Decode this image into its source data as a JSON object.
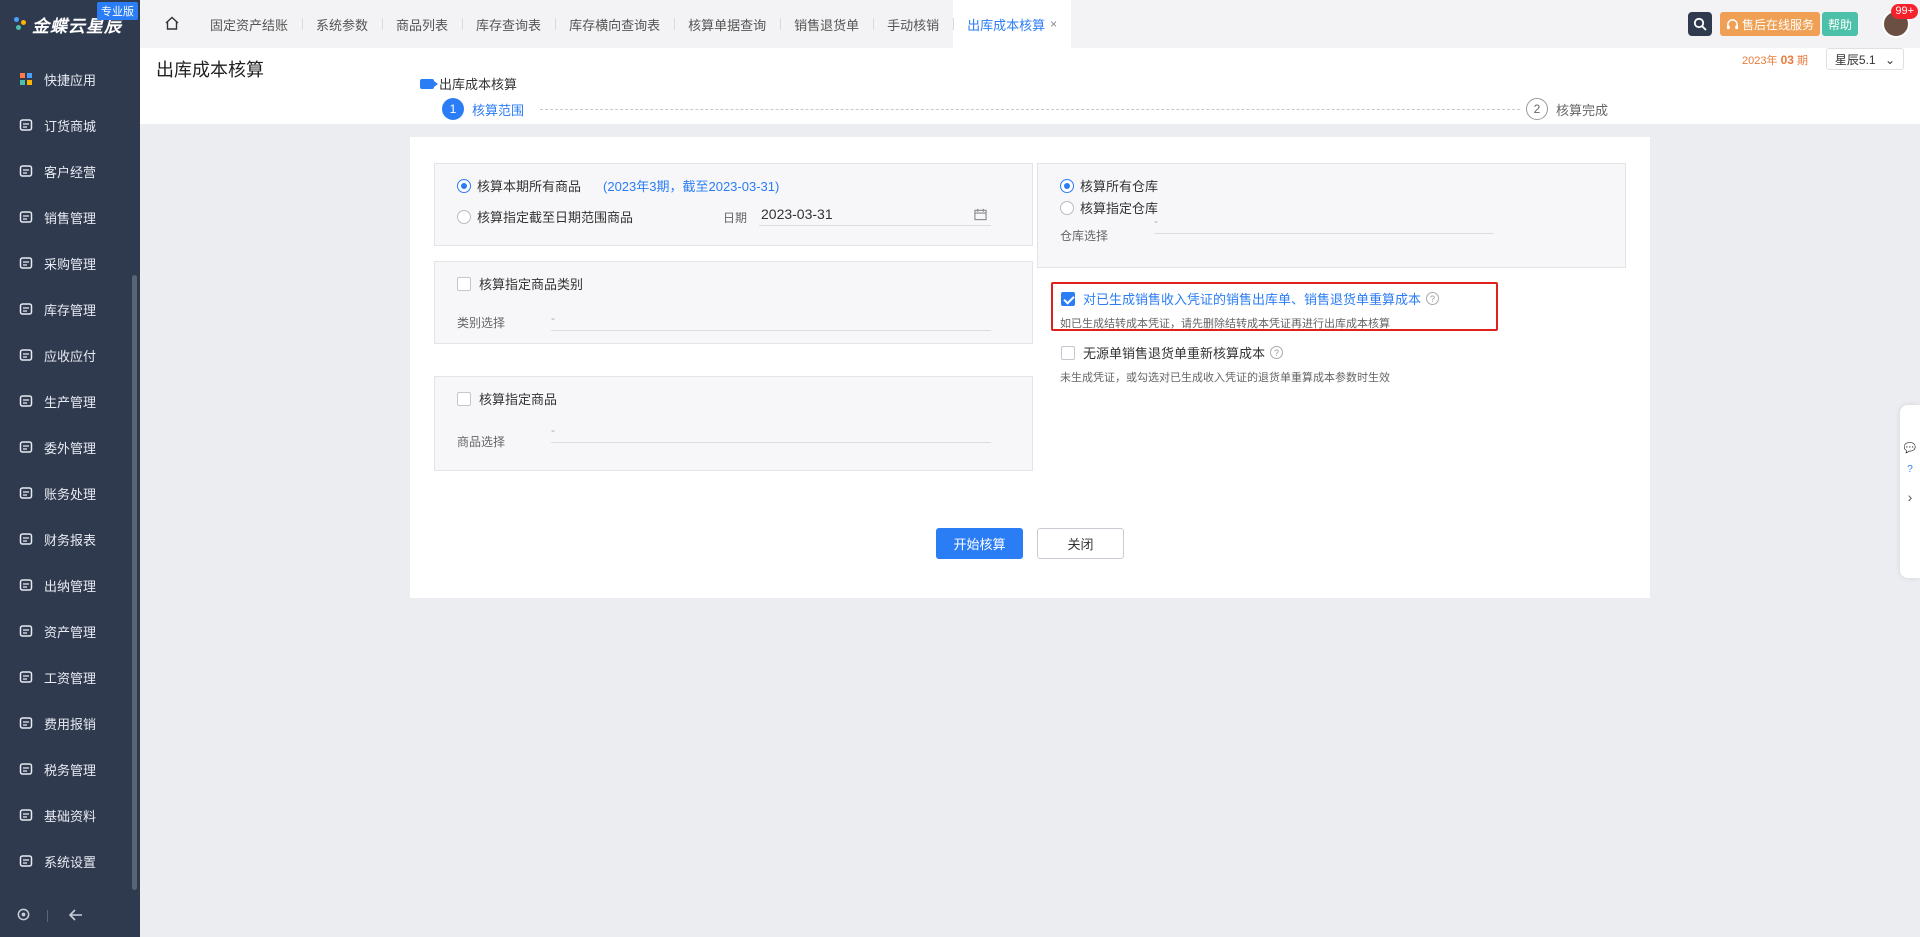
{
  "brand": {
    "name": "金蝶云星辰",
    "edition": "专业版"
  },
  "sidebar": {
    "items": [
      {
        "label": "快捷应用",
        "icon": "grid-icon"
      },
      {
        "label": "订货商城",
        "icon": "shopping-bag-icon"
      },
      {
        "label": "客户经营",
        "icon": "user-icon"
      },
      {
        "label": "销售管理",
        "icon": "chart-icon"
      },
      {
        "label": "采购管理",
        "icon": "cart-icon"
      },
      {
        "label": "库存管理",
        "icon": "box-icon"
      },
      {
        "label": "应收应付",
        "icon": "diamond-icon"
      },
      {
        "label": "生产管理",
        "icon": "factory-icon"
      },
      {
        "label": "委外管理",
        "icon": "outsource-icon"
      },
      {
        "label": "账务处理",
        "icon": "ledger-icon"
      },
      {
        "label": "财务报表",
        "icon": "report-icon"
      },
      {
        "label": "出纳管理",
        "icon": "cashier-icon"
      },
      {
        "label": "资产管理",
        "icon": "archive-icon"
      },
      {
        "label": "工资管理",
        "icon": "salary-icon"
      },
      {
        "label": "费用报销",
        "icon": "expense-icon"
      },
      {
        "label": "税务管理",
        "icon": "tax-icon"
      },
      {
        "label": "基础资料",
        "icon": "layers-icon"
      },
      {
        "label": "系统设置",
        "icon": "settings-hex-icon"
      }
    ]
  },
  "tabs": [
    {
      "label": "固定资产结账"
    },
    {
      "label": "系统参数"
    },
    {
      "label": "商品列表"
    },
    {
      "label": "库存查询表"
    },
    {
      "label": "库存横向查询表"
    },
    {
      "label": "核算单据查询"
    },
    {
      "label": "销售退货单"
    },
    {
      "label": "手动核销"
    },
    {
      "label": "出库成本核算",
      "active": true
    }
  ],
  "topbar": {
    "service_label": "售后在线服务",
    "help_label": "帮助",
    "notification_count": "99+"
  },
  "page": {
    "title": "出库成本核算",
    "period_year": "2023年",
    "period_num": "03",
    "period_suffix": "期",
    "ledger": "星辰5.1",
    "steps_title": "出库成本核算",
    "step1": {
      "num": "1",
      "label": "核算范围"
    },
    "step2": {
      "num": "2",
      "label": "核算完成"
    }
  },
  "form": {
    "opt_all_goods": "核算本期所有商品",
    "period_note": "(2023年3期，截至2023-03-31)",
    "opt_date_range": "核算指定截至日期范围商品",
    "date_label": "日期",
    "date_value": "2023-03-31",
    "category_check": "核算指定商品类别",
    "category_label": "类别选择",
    "category_value": "-",
    "goods_check": "核算指定商品",
    "goods_label": "商品选择",
    "goods_value": "-",
    "opt_all_warehouses": "核算所有仓库",
    "opt_specific_warehouse": "核算指定仓库",
    "warehouse_label": "仓库选择",
    "warehouse_value": "-",
    "recalc_check": "对已生成销售收入凭证的销售出库单、销售退货单重算成本",
    "recalc_note": "如已生成结转成本凭证，请先删除结转成本凭证再进行出库成本核算",
    "nosource_check": "无源单销售退货单重新核算成本",
    "nosource_note": "未生成凭证，或勾选对已生成收入凭证的退货单重算成本参数时生效",
    "start_button": "开始核算",
    "close_button": "关闭"
  },
  "colors": {
    "accent": "#2b7df6",
    "sidebar_bg": "#2f3a4f",
    "highlight": "#e0201b"
  }
}
